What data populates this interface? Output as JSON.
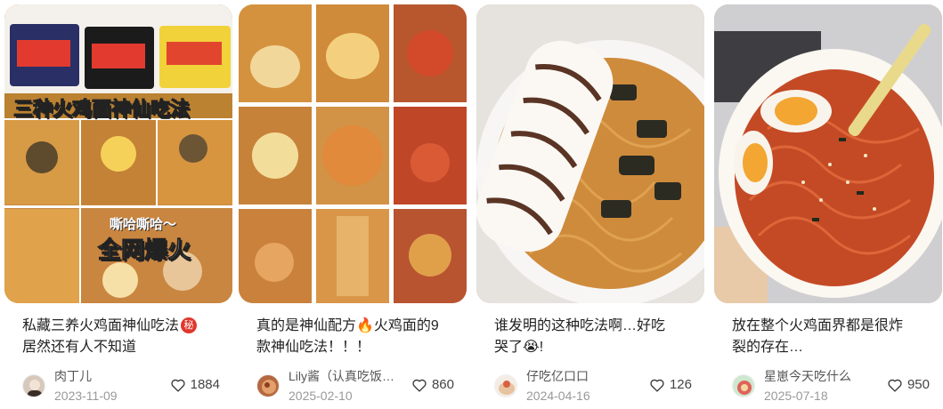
{
  "cards": [
    {
      "title_line1": "私藏三养火鸡面神仙吃法",
      "title_line2": "居然还有人不知道",
      "badge": "秘",
      "cover_title": "三种火鸡面神仙吃法",
      "cover_sub": "嘶哈嘶哈～",
      "cover_big": "全网爆火",
      "author": "肉丁儿",
      "date": "2023-11-09",
      "likes": "1884"
    },
    {
      "title_line1": "真的是神仙配方🔥火鸡面的9",
      "title_line2": "款神仙吃法！！！",
      "author": "Lily酱（认真吃饭…",
      "date": "2025-02-10",
      "likes": "860"
    },
    {
      "title_line1": "谁发明的这种吃法啊…好吃",
      "title_line2": "哭了😭!",
      "author": "仔吃亿口口",
      "date": "2024-04-16",
      "likes": "126"
    },
    {
      "title_line1": "放在整个火鸡面界都是很炸",
      "title_line2": "裂的存在…",
      "author": "星崽今天吃什么",
      "date": "2025-07-18",
      "likes": "950"
    }
  ],
  "colors": {
    "noodle": "#d8933f",
    "sauce": "#c2411f",
    "badge": "#e0372c"
  }
}
